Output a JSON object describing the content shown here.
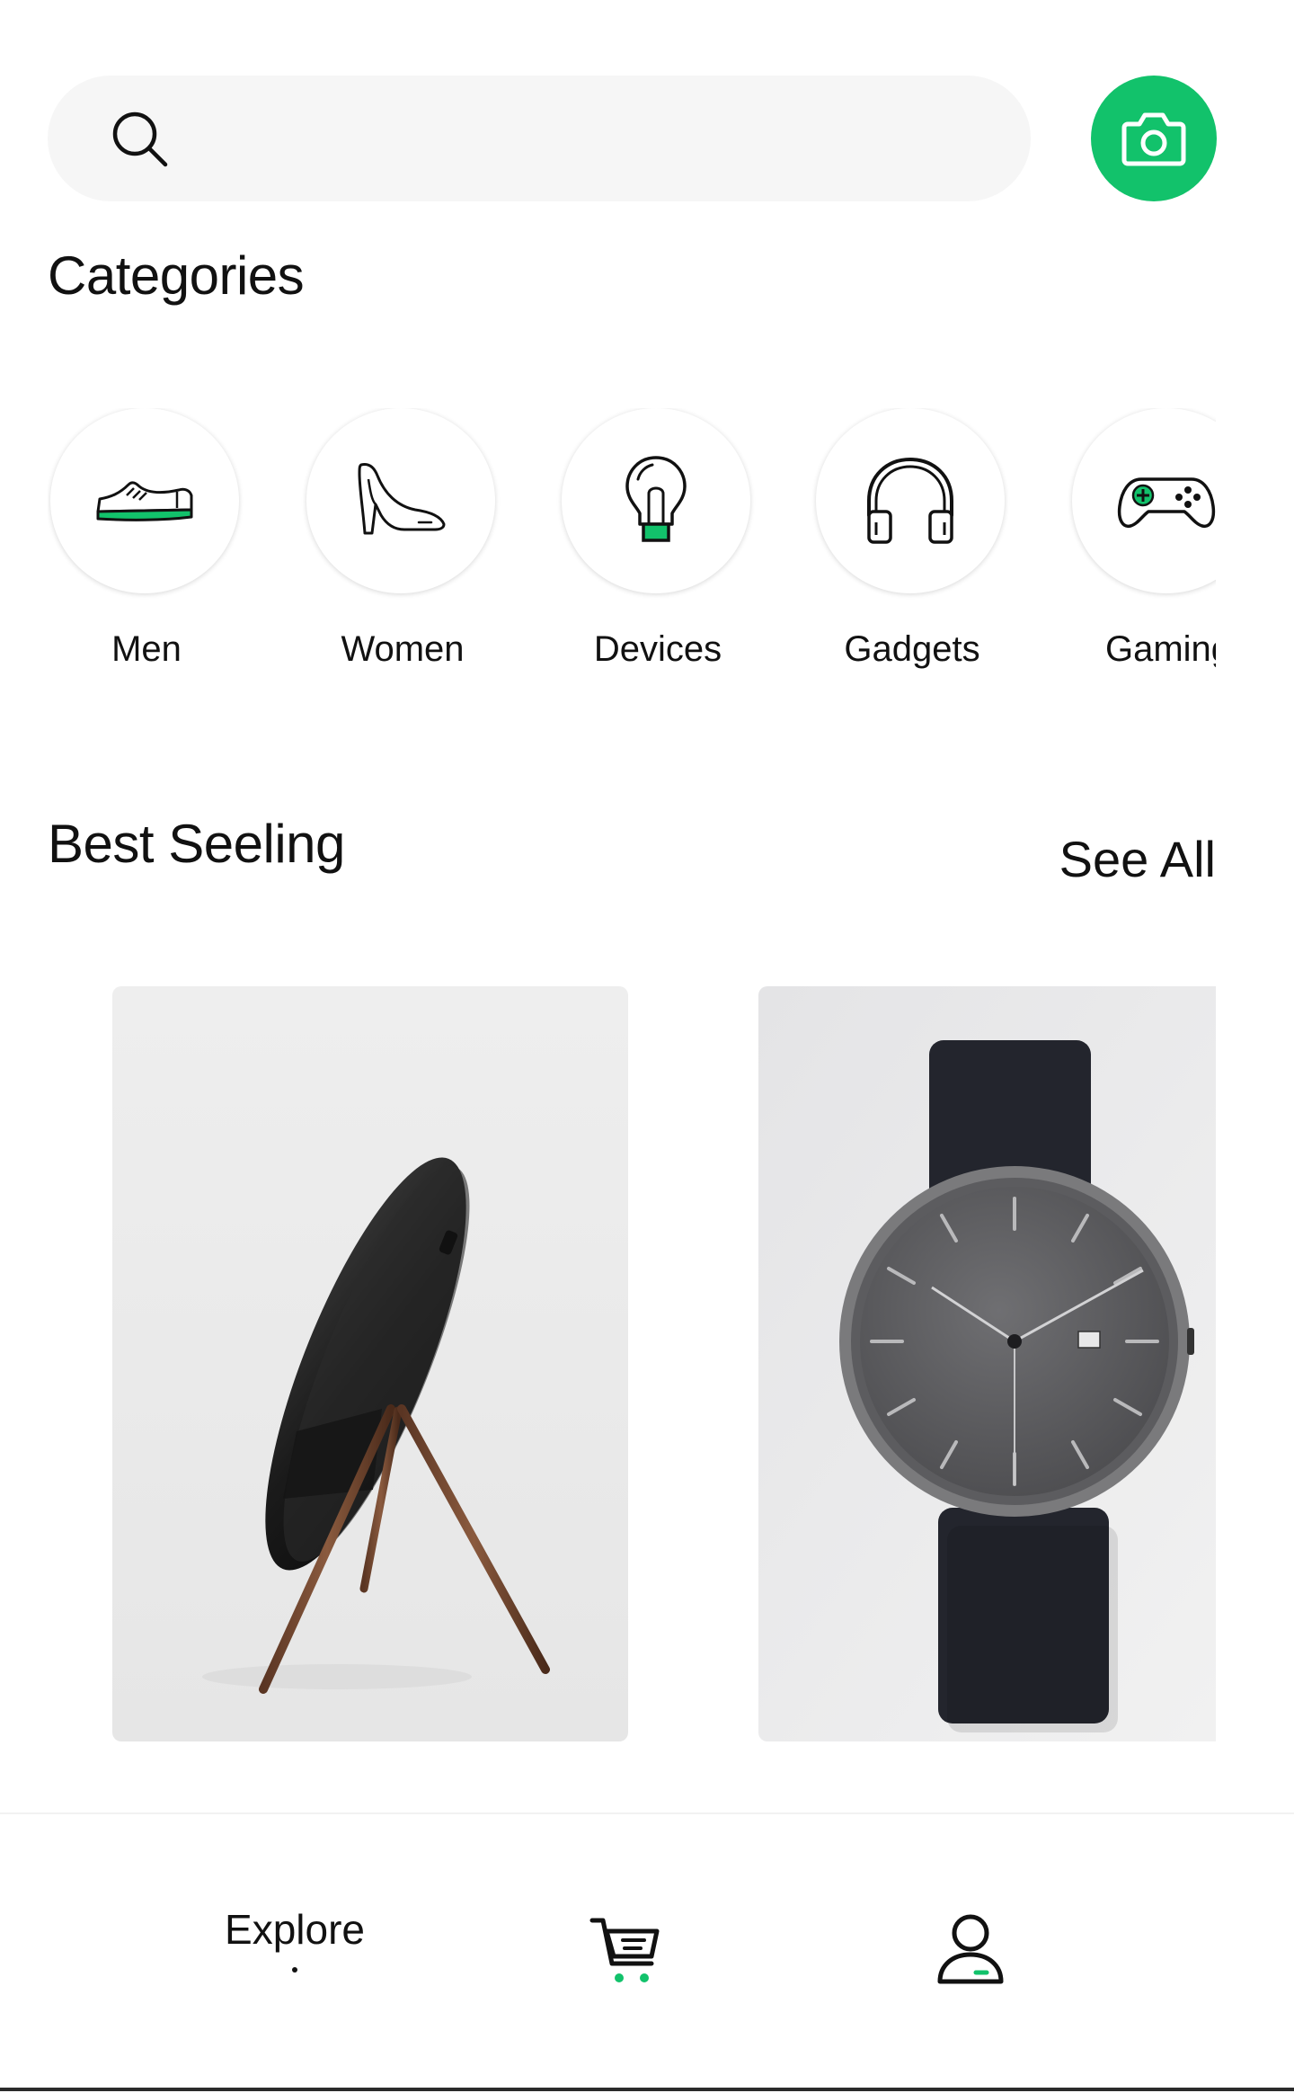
{
  "search": {
    "value": "",
    "icon": "search-icon"
  },
  "camera_button": {
    "icon": "camera-icon",
    "color": "#12c26b"
  },
  "categories": {
    "title": "Categories",
    "items": [
      {
        "label": "Men",
        "icon": "sneaker-icon"
      },
      {
        "label": "Women",
        "icon": "high-heel-icon"
      },
      {
        "label": "Devices",
        "icon": "lightbulb-icon"
      },
      {
        "label": "Gadgets",
        "icon": "headphones-icon"
      },
      {
        "label": "Gaming",
        "icon": "gamepad-icon"
      }
    ]
  },
  "best_selling": {
    "title": "Best Seeling",
    "see_all_label": "See All",
    "products": [
      {
        "image": "speaker-on-wooden-stand"
      },
      {
        "image": "minimalist-wristwatch"
      }
    ]
  },
  "bottom_nav": {
    "items": [
      {
        "label": "Explore",
        "active": true
      },
      {
        "icon": "cart-icon"
      },
      {
        "icon": "profile-icon"
      }
    ]
  },
  "colors": {
    "accent": "#12c26b",
    "background": "#ffffff",
    "search_bg": "#f6f6f6",
    "text": "#111111"
  }
}
